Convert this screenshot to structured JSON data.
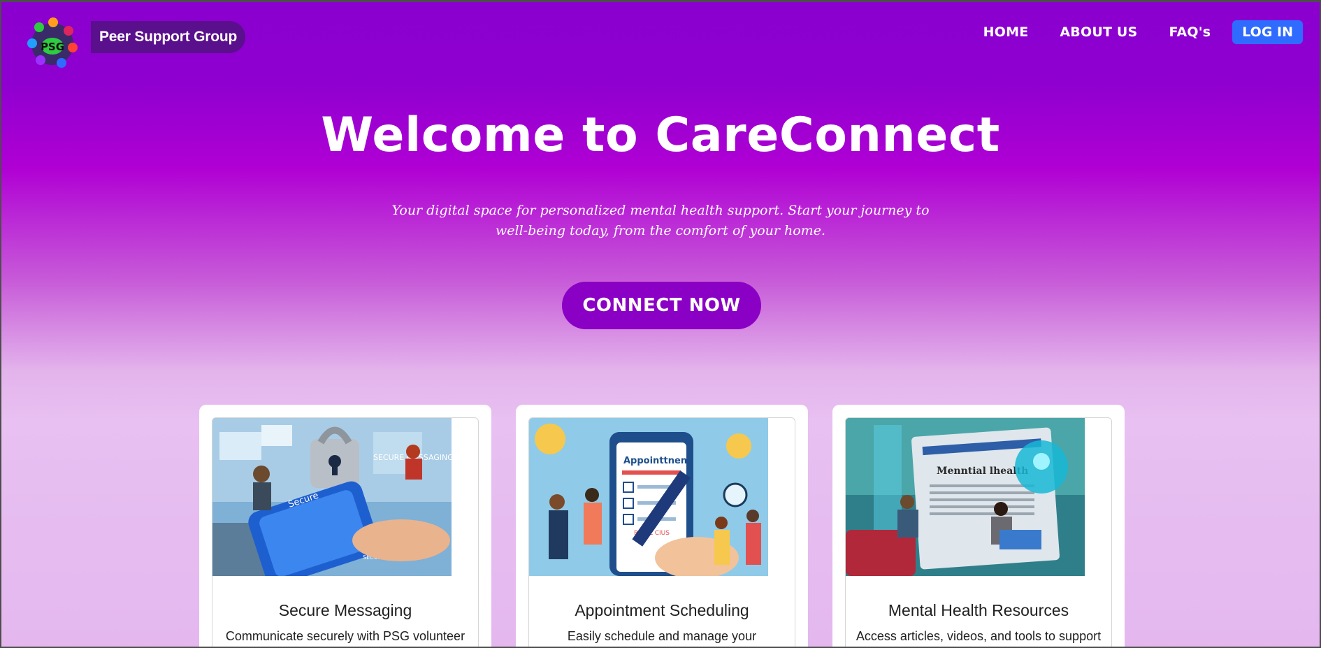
{
  "nav": {
    "brand": "Peer Support Group",
    "logo_text": "PSG",
    "links": [
      "HOME",
      "ABOUT US",
      "FAQ's"
    ],
    "login": "LOG IN"
  },
  "hero": {
    "title": "Welcome to CareConnect",
    "subtitle": "Your digital space for personalized mental health support. Start your journey to well-being today, from the comfort of your home.",
    "cta": "CONNECT NOW"
  },
  "cards": [
    {
      "title": "Secure Messaging",
      "text": "Communicate securely with PSG volunteer using our built-in messaging system.",
      "img_text_1": "Secure",
      "img_text_2": "SECURE MASSAGING",
      "img_text_3": "SECUR"
    },
    {
      "title": "Appointment Scheduling",
      "text": "Easily schedule and manage your counseling appointments.",
      "img_text_1": "Appointtnent",
      "img_text_2": "RU AL CIUS"
    },
    {
      "title": "Mental Health Resources",
      "text": "Access articles, videos, and tools to support your well-being.",
      "img_text_1": "Menntial lhealth"
    }
  ],
  "colors": {
    "accent": "#8a00c4",
    "login": "#2f6bff",
    "brand_pill": "#5a0f8c"
  }
}
